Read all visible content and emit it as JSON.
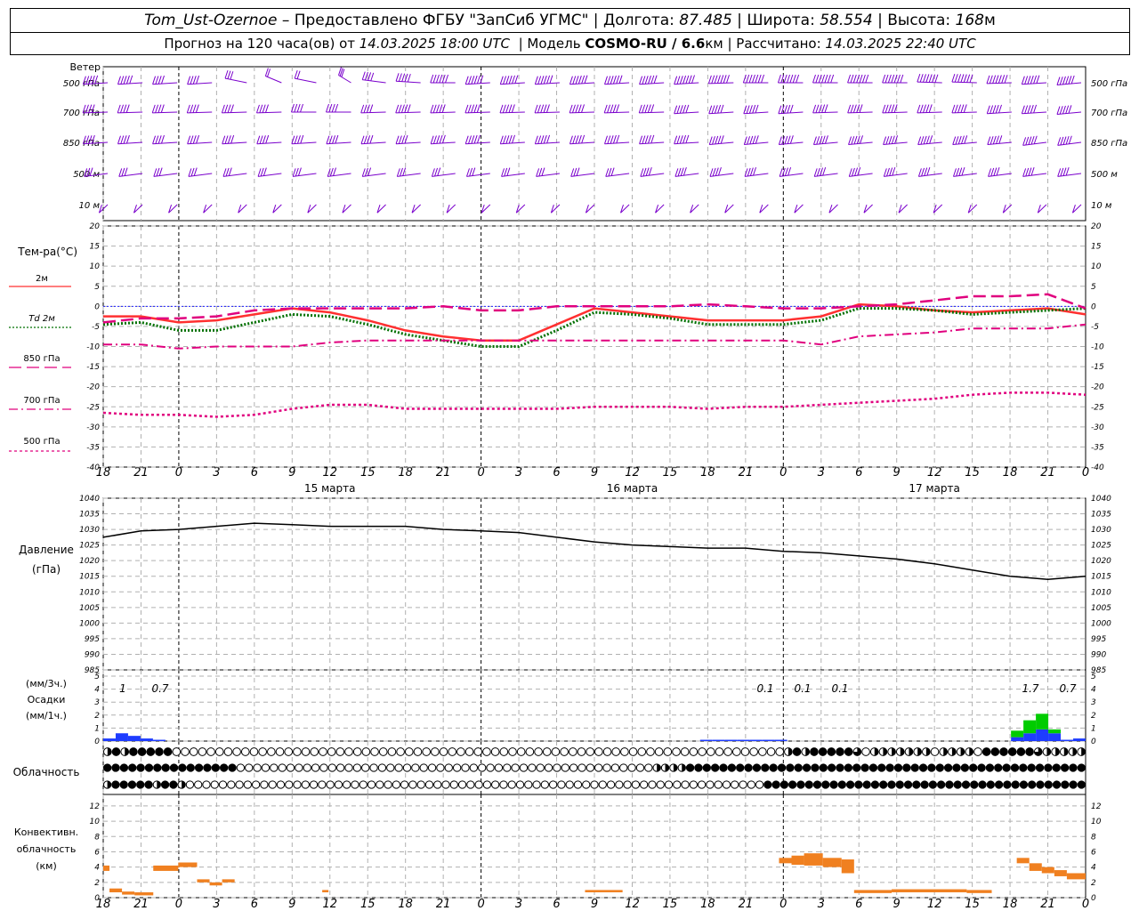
{
  "header": {
    "station": "Tom_Ust-Ozernoe",
    "provider": "– Предоставлено ФГБУ \"ЗапСиб УГМС\"",
    "lon_label": "Долгота:",
    "lon_value": "87.485",
    "lat_label": "Широта:",
    "lat_value": "58.554",
    "alt_label": "Высота:",
    "alt_value": "168",
    "alt_unit": "м",
    "forecast_text": "Прогноз на 120 часа(ов) от",
    "forecast_time": "14.03.2025 18:00 UTC",
    "model_label": "| Модель",
    "model_name": "COSMO-RU / 6.6",
    "model_unit": "км",
    "calc_label": "| Рассчитано:",
    "calc_time": "14.03.2025 22:40 UTC"
  },
  "colors": {
    "wind": "#7a00cc",
    "t2m": "#ff3030",
    "td2m": "#007000",
    "level": "#e0007e",
    "pressure": "#000000",
    "precip_3h": "#1e3cff",
    "precip_1h": "#00cc00",
    "convective": "#f08020",
    "zero_line": "#2020ff"
  },
  "x_axis": {
    "ticks": [
      "18",
      "21",
      "0",
      "3",
      "6",
      "9",
      "12",
      "15",
      "18",
      "21",
      "0",
      "3",
      "6",
      "9",
      "12",
      "15",
      "18",
      "21",
      "0",
      "3",
      "6",
      "9",
      "12",
      "15",
      "18",
      "21",
      "0"
    ],
    "dates": [
      "15 марта",
      "16 марта",
      "17 марта"
    ]
  },
  "wind_panel": {
    "title": "Ветер",
    "levels": [
      "500 гПа",
      "700 гПа",
      "850 гПа",
      "500 м",
      "10 м"
    ]
  },
  "temp_panel": {
    "title": "Тем-ра(°C)",
    "legend": [
      "2м",
      "Td 2м",
      "850 гПа",
      "700 гПа",
      "500 гПа"
    ],
    "ylim": [
      -40,
      20
    ],
    "yticks": [
      "20",
      "15",
      "10",
      "5",
      "0",
      "-5",
      "-10",
      "-15",
      "-20",
      "-25",
      "-30",
      "-35",
      "-40"
    ]
  },
  "pressure_panel": {
    "title": "Давление",
    "unit": "(гПа)",
    "ylim": [
      985,
      1040
    ],
    "yticks": [
      "1040",
      "1035",
      "1030",
      "1025",
      "1020",
      "1015",
      "1010",
      "1005",
      "1000",
      "995",
      "990",
      "985"
    ]
  },
  "precip_panel": {
    "unit3": "(мм/3ч.)",
    "title": "Осадки",
    "unit1": "(мм/1ч.)",
    "yticks": [
      "5",
      "4",
      "3",
      "2",
      "1",
      "0"
    ],
    "labels": [
      "1",
      "0.7",
      "0.1",
      "0.1",
      "0.1",
      "1.7",
      "0.7"
    ]
  },
  "cloud_panel": {
    "title": "Облачность"
  },
  "conv_panel": {
    "title1": "Конвективн.",
    "title2": "облачность",
    "unit": "(км)",
    "yticks": [
      "12",
      "10",
      "8",
      "6",
      "4",
      "2",
      "0"
    ]
  },
  "chart_data": {
    "type": "line",
    "x_hours": [
      0,
      3,
      6,
      9,
      12,
      15,
      18,
      21,
      24,
      27,
      30,
      33,
      36,
      39,
      42,
      45,
      48,
      51,
      54,
      57,
      60,
      63,
      66,
      69,
      72,
      75,
      78
    ],
    "series": [
      {
        "name": "2м",
        "values": [
          -2.5,
          -2.5,
          -4,
          -3.5,
          -2,
          -0.5,
          -1.5,
          -3.5,
          -6,
          -7.5,
          -8.5,
          -8.5,
          -4.5,
          -0.5,
          -1.5,
          -2.5,
          -3.5,
          -3.5,
          -3.5,
          -2.5,
          0.5,
          0,
          -1,
          -1.5,
          -1,
          -0.5,
          -2
        ]
      },
      {
        "name": "Td 2м",
        "values": [
          -4.5,
          -4,
          -6,
          -6,
          -4,
          -2,
          -2.5,
          -4.5,
          -7,
          -8.5,
          -10,
          -10,
          -6,
          -1.5,
          -2,
          -3,
          -4.5,
          -4.5,
          -4.5,
          -3.5,
          -0.5,
          -0.5,
          -1,
          -2,
          -1.5,
          -1,
          -0.5
        ]
      },
      {
        "name": "850 гПа",
        "values": [
          -4,
          -3,
          -3,
          -2.5,
          -1,
          -0.5,
          -0.5,
          -0.5,
          -0.5,
          0,
          -1,
          -1,
          0,
          0,
          0,
          0,
          0.5,
          0,
          -0.5,
          -0.5,
          0,
          0.5,
          1.5,
          2.5,
          2.5,
          3,
          -0.5
        ]
      },
      {
        "name": "700 гПа",
        "values": [
          -9.5,
          -9.5,
          -10.5,
          -10,
          -10,
          -10,
          -9,
          -8.5,
          -8.5,
          -8.5,
          -8.5,
          -8.5,
          -8.5,
          -8.5,
          -8.5,
          -8.5,
          -8.5,
          -8.5,
          -8.5,
          -9.5,
          -7.5,
          -7,
          -6.5,
          -5.5,
          -5.5,
          -5.5,
          -4.5
        ]
      },
      {
        "name": "500 гПа",
        "values": [
          -26.5,
          -27,
          -27,
          -27.5,
          -27,
          -25.5,
          -24.5,
          -24.5,
          -25.5,
          -25.5,
          -25.5,
          -25.5,
          -25.5,
          -25,
          -25,
          -25,
          -25.5,
          -25,
          -25,
          -24.5,
          -24,
          -23.5,
          -23,
          -22,
          -21.5,
          -21.5,
          -22
        ]
      },
      {
        "name": "Давление",
        "values": [
          1027.5,
          1029.5,
          1030,
          1031,
          1032,
          1031.5,
          1031,
          1031,
          1031,
          1030,
          1029.5,
          1029,
          1027.5,
          1026,
          1025,
          1024.5,
          1024,
          1024,
          1023,
          1022.5,
          1021.5,
          1020.5,
          1019,
          1017,
          1015,
          1014,
          1015
        ]
      }
    ],
    "precip_3h_mm": [
      0.2,
      0.6,
      0.4,
      0.2,
      0.1,
      0,
      0,
      0,
      0,
      0,
      0,
      0,
      0,
      0,
      0,
      0,
      0,
      0,
      0,
      0,
      0,
      0,
      0,
      0,
      0,
      0,
      0,
      0,
      0,
      0,
      0,
      0,
      0,
      0,
      0,
      0,
      0,
      0,
      0,
      0,
      0,
      0,
      0,
      0,
      0,
      0,
      0,
      0,
      0.1,
      0.1,
      0.1,
      0.1,
      0.1,
      0.1,
      0.1,
      0,
      0,
      0,
      0,
      0,
      0,
      0,
      0,
      0,
      0,
      0,
      0,
      0,
      0,
      0,
      0,
      0,
      0,
      0.3,
      0.6,
      0.9,
      0.6,
      0.1,
      0.2
    ],
    "precip_1h_mm": [
      0,
      0,
      0,
      0,
      0,
      0,
      0,
      0,
      0,
      0,
      0,
      0,
      0,
      0,
      0,
      0,
      0,
      0,
      0,
      0,
      0,
      0,
      0,
      0,
      0,
      0,
      0,
      0,
      0,
      0,
      0,
      0,
      0,
      0,
      0,
      0,
      0,
      0,
      0,
      0,
      0,
      0,
      0,
      0,
      0,
      0,
      0,
      0,
      0,
      0,
      0,
      0,
      0,
      0,
      0,
      0,
      0,
      0,
      0,
      0,
      0,
      0,
      0,
      0,
      0,
      0,
      0,
      0,
      0,
      0,
      0,
      0,
      0,
      0.5,
      1.0,
      1.2,
      0.3,
      0,
      0
    ],
    "cloud_rows": [
      "hbhbbbbbqqqqqqqqqqqqqqqqqqqqqqqqqqqqqqqqqqqqqqqqqqqqqqqqqqqqqqqqqqqqqqqqqqqqqqqhbhbbbbbtqhhhhhhhqhhhhqbbbbbbthhhhh",
      "bbbbbbbbbbbbbbbbqqqqqqqqqqqqqqqqqqqqqqqqqqqqqqqqqqqqqqqqqqqqqqqqqqhhhhbbbbbbbbbbbbbbbbbbbbbbbbbbbbbbbbbbbbbbbbbbbbbbbb",
      "hbbbbbhbbhqqqqqqqqqqqqqqqqqqqqqqqqqqqqqqqqqqqqqqqqqqqqqqqqqqqqqqqqqqqqqqqqqqqqqqbbbbbbbbbbbbbbbbbbbbbbbbbbbbbbbbbbbbbbb"
    ],
    "convective_bars": [
      {
        "t0": 0,
        "t1": 1,
        "base": 3.5,
        "top": 4.2
      },
      {
        "t0": 1,
        "t1": 3,
        "base": 0.7,
        "top": 1.2
      },
      {
        "t0": 3,
        "t1": 5,
        "base": 0.4,
        "top": 0.8
      },
      {
        "t0": 5,
        "t1": 8,
        "base": 0.3,
        "top": 0.7
      },
      {
        "t0": 8,
        "t1": 12,
        "base": 3.5,
        "top": 4.2
      },
      {
        "t0": 12,
        "t1": 15,
        "base": 4.0,
        "top": 4.6
      },
      {
        "t0": 15,
        "t1": 17,
        "base": 2.0,
        "top": 2.4
      },
      {
        "t0": 17,
        "t1": 19,
        "base": 1.6,
        "top": 2.0
      },
      {
        "t0": 19,
        "t1": 21,
        "base": 2.0,
        "top": 2.4
      },
      {
        "t0": 35,
        "t1": 36,
        "base": 0.7,
        "top": 1.0
      },
      {
        "t0": 77,
        "t1": 83,
        "base": 0.7,
        "top": 1.0
      },
      {
        "t0": 108,
        "t1": 110,
        "base": 4.5,
        "top": 5.2
      },
      {
        "t0": 110,
        "t1": 112,
        "base": 4.3,
        "top": 5.5
      },
      {
        "t0": 112,
        "t1": 115,
        "base": 4.2,
        "top": 5.8
      },
      {
        "t0": 115,
        "t1": 118,
        "base": 4.0,
        "top": 5.2
      },
      {
        "t0": 118,
        "t1": 120,
        "base": 3.2,
        "top": 5.0
      },
      {
        "t0": 120,
        "t1": 126,
        "base": 0.6,
        "top": 1.0
      },
      {
        "t0": 126,
        "t1": 138,
        "base": 0.7,
        "top": 1.1
      },
      {
        "t0": 138,
        "t1": 142,
        "base": 0.6,
        "top": 1.0
      },
      {
        "t0": 146,
        "t1": 148,
        "base": 4.5,
        "top": 5.2
      },
      {
        "t0": 148,
        "t1": 150,
        "base": 3.5,
        "top": 4.5
      },
      {
        "t0": 150,
        "t1": 152,
        "base": 3.2,
        "top": 4.0
      },
      {
        "t0": 152,
        "t1": 154,
        "base": 2.8,
        "top": 3.6
      },
      {
        "t0": 154,
        "t1": 157,
        "base": 2.4,
        "top": 3.2
      }
    ],
    "wind_profile": [
      {
        "level": "500 гПа",
        "dir": [
          260,
          260,
          260,
          260,
          300,
          320,
          300,
          330,
          290,
          280,
          270,
          260,
          260,
          260,
          260,
          260,
          260,
          260,
          265,
          270,
          270,
          270,
          270,
          270,
          275,
          275,
          265,
          260,
          255
        ],
        "speed": [
          25,
          25,
          20,
          20,
          15,
          10,
          10,
          15,
          20,
          25,
          30,
          30,
          30,
          30,
          30,
          30,
          30,
          35,
          35,
          35,
          35,
          35,
          35,
          35,
          35,
          35,
          35,
          30,
          30
        ]
      },
      {
        "level": "700 гПа",
        "dir": [
          265,
          265,
          265,
          265,
          265,
          265,
          270,
          270,
          265,
          265,
          265,
          265,
          265,
          265,
          265,
          265,
          265,
          260,
          260,
          260,
          260,
          265,
          265,
          265,
          265,
          265,
          260,
          260,
          255
        ],
        "speed": [
          20,
          20,
          20,
          20,
          20,
          20,
          20,
          20,
          20,
          25,
          25,
          25,
          25,
          25,
          25,
          25,
          25,
          25,
          25,
          25,
          25,
          25,
          25,
          25,
          25,
          25,
          25,
          25,
          25
        ]
      },
      {
        "level": "850 гПа",
        "dir": [
          260,
          260,
          260,
          260,
          260,
          260,
          260,
          260,
          260,
          260,
          260,
          260,
          260,
          260,
          260,
          260,
          260,
          260,
          255,
          255,
          255,
          255,
          255,
          255,
          255,
          255,
          255,
          250,
          250
        ],
        "speed": [
          20,
          20,
          20,
          20,
          20,
          20,
          20,
          20,
          20,
          20,
          25,
          25,
          25,
          25,
          25,
          25,
          25,
          25,
          25,
          25,
          25,
          25,
          25,
          25,
          25,
          25,
          25,
          25,
          25
        ]
      },
      {
        "level": "500 м",
        "dir": [
          250,
          250,
          250,
          250,
          250,
          250,
          250,
          250,
          250,
          250,
          250,
          250,
          250,
          250,
          250,
          250,
          250,
          250,
          250,
          250,
          250,
          250,
          250,
          250,
          250,
          250,
          250,
          250,
          250
        ],
        "speed": [
          15,
          15,
          15,
          15,
          15,
          15,
          15,
          15,
          15,
          15,
          15,
          15,
          15,
          15,
          15,
          15,
          20,
          20,
          20,
          20,
          20,
          20,
          20,
          20,
          20,
          20,
          20,
          20,
          20
        ]
      },
      {
        "level": "10 м",
        "dir": [
          200,
          200,
          200,
          200,
          200,
          200,
          200,
          200,
          200,
          200,
          200,
          200,
          200,
          200,
          200,
          200,
          200,
          200,
          200,
          200,
          200,
          200,
          200,
          200,
          200,
          200,
          200,
          200,
          200
        ],
        "speed": [
          5,
          5,
          5,
          5,
          5,
          5,
          5,
          5,
          5,
          5,
          5,
          5,
          5,
          5,
          5,
          5,
          5,
          5,
          5,
          5,
          5,
          5,
          5,
          5,
          5,
          5,
          5,
          5,
          5
        ]
      }
    ]
  }
}
